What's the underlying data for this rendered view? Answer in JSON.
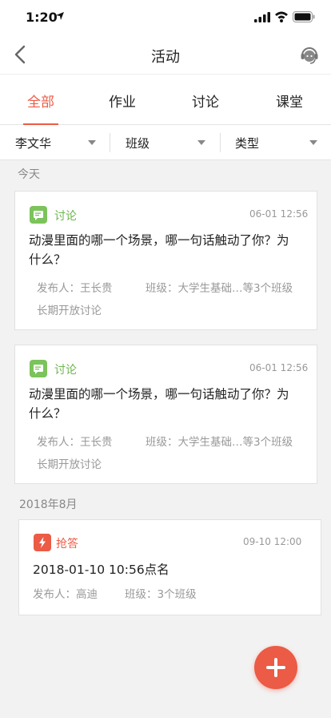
{
  "status_bar": {
    "time": "1:20"
  },
  "nav": {
    "title": "活动"
  },
  "tabs": [
    {
      "label": "全部",
      "active": true
    },
    {
      "label": "作业",
      "active": false
    },
    {
      "label": "讨论",
      "active": false
    },
    {
      "label": "课堂",
      "active": false
    }
  ],
  "filters": [
    {
      "label": "李文华"
    },
    {
      "label": "班级"
    },
    {
      "label": "类型"
    }
  ],
  "sections": [
    {
      "label": "今天"
    },
    {
      "label": "2018年8月"
    }
  ],
  "cards": [
    {
      "type": "讨论",
      "time": "06-01 12:56",
      "title_line1": "动漫里面的哪一个场景，哪一句话触动了你？为",
      "title_line2": "什么？",
      "publisher_label": "发布人：",
      "publisher": "王长贵",
      "class_label": "班级：",
      "class_value": "大学生基础…等3个班级",
      "extra": "长期开放讨论"
    },
    {
      "type": "讨论",
      "time": "06-01 12:56",
      "title_line1": "动漫里面的哪一个场景，哪一句话触动了你？为",
      "title_line2": "什么？",
      "publisher_label": "发布人：",
      "publisher": "王长贵",
      "class_label": "班级：",
      "class_value": "大学生基础…等3个班级",
      "extra": "长期开放讨论"
    },
    {
      "type": "抢答",
      "time": "09-10 12:00",
      "title_line1": "2018-01-10 10:56点名",
      "publisher_label": "发布人：",
      "publisher": "高迪",
      "class_label": "班级：",
      "class_value": "3个班级"
    }
  ],
  "colors": {
    "accent": "#ec5b45",
    "discuss_green": "#7bc35a"
  }
}
